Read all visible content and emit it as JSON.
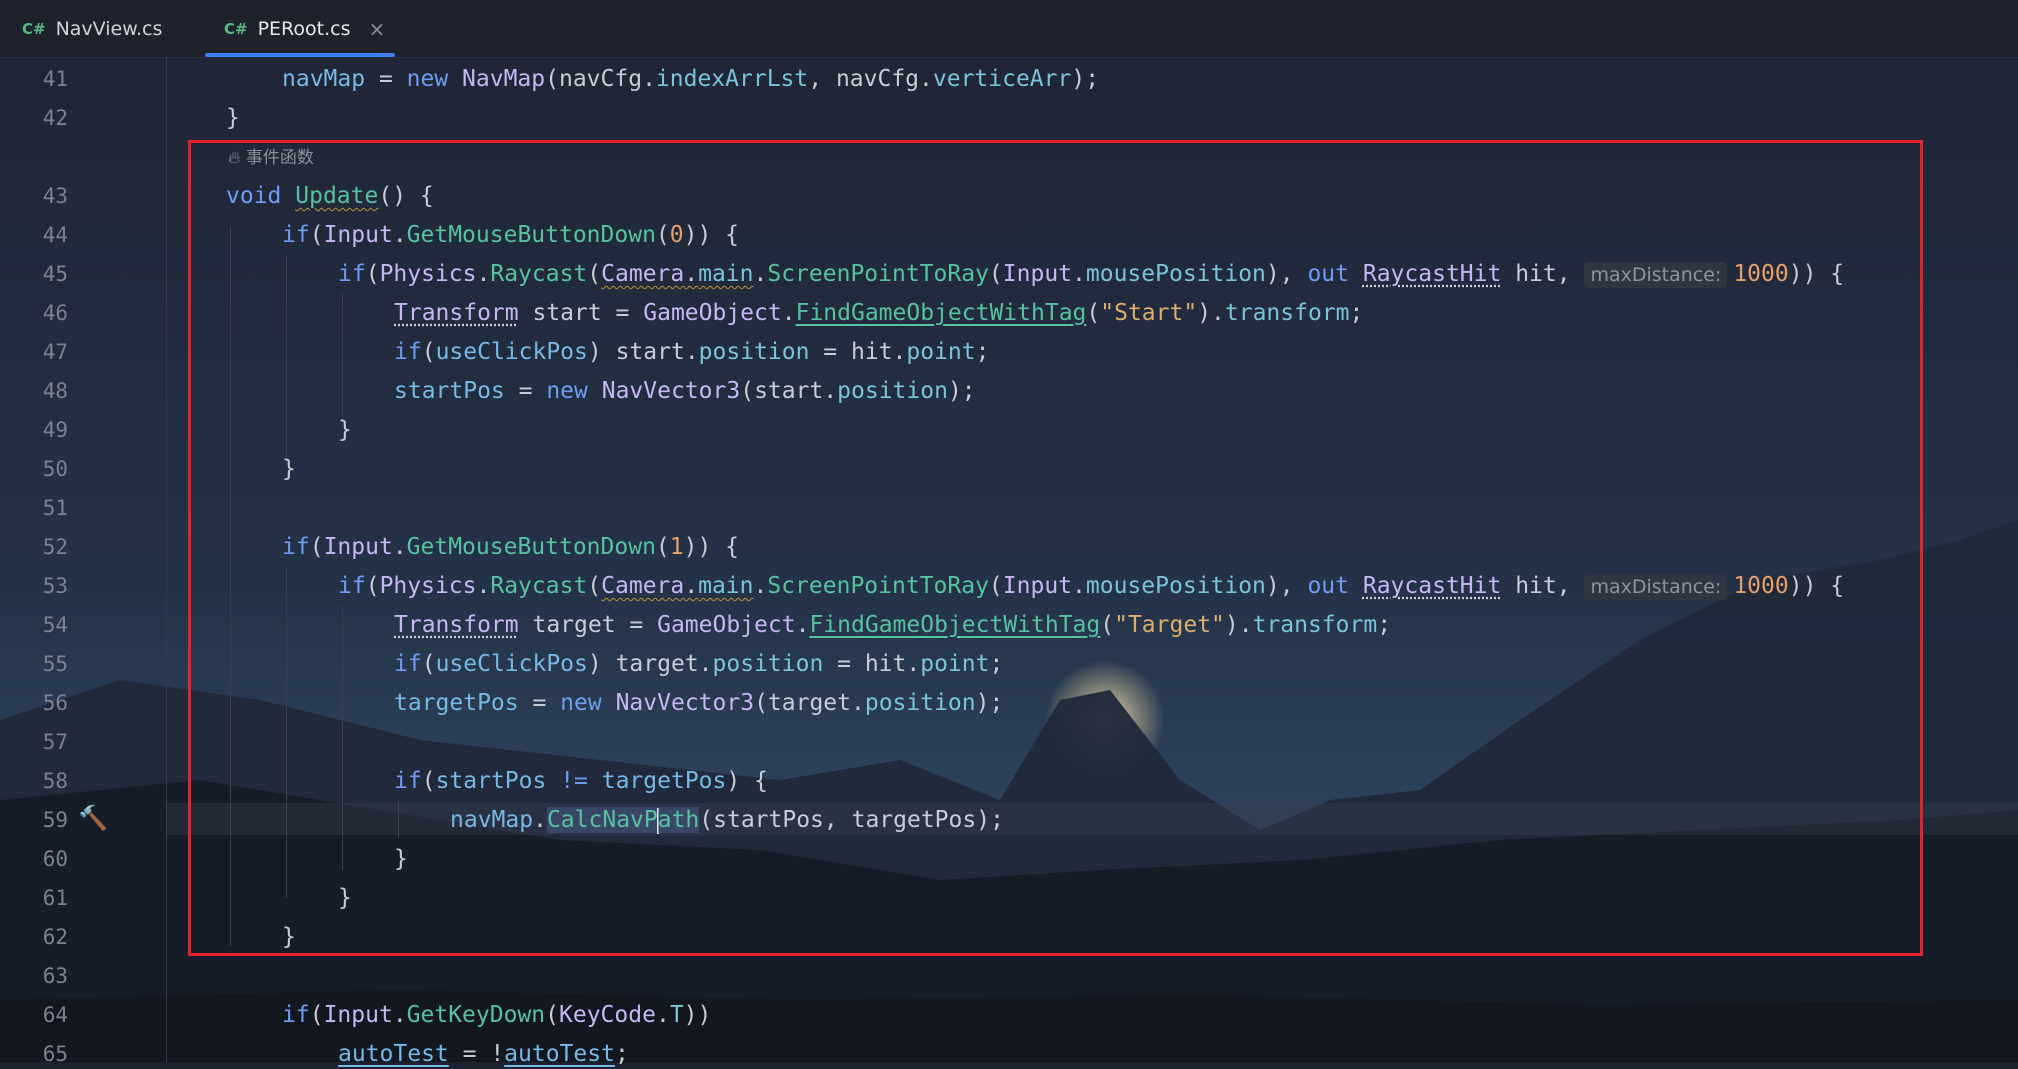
{
  "tabs": [
    {
      "lang": "C#",
      "label": "NavView.cs",
      "active": false
    },
    {
      "lang": "C#",
      "label": "PERoot.cs",
      "active": true,
      "close": "×"
    }
  ],
  "codevision": {
    "icon": "flame-icon",
    "label": "事件函数"
  },
  "line_numbers": [
    "41",
    "42",
    "43",
    "44",
    "45",
    "46",
    "47",
    "48",
    "49",
    "50",
    "51",
    "52",
    "53",
    "54",
    "55",
    "56",
    "57",
    "58",
    "59",
    "60",
    "61",
    "62",
    "63",
    "64",
    "65"
  ],
  "code": {
    "l41": {
      "navMap": "navMap",
      "eq": " = ",
      "new": "new",
      "NavMap": "NavMap",
      "args": "(navCfg.",
      "indexArrLst": "indexArrLst",
      ",": ", navCfg.",
      "verticeArr": "verticeArr",
      "end": ");"
    },
    "l42": "}",
    "l43": {
      "void": "void",
      "Update": "Update",
      "rest": "() {"
    },
    "l44": {
      "if": "if",
      "open": "(",
      "Input": "Input",
      "dot": ".",
      "GetMouseButtonDown": "GetMouseButtonDown",
      "p": "(",
      "n": "0",
      "end": ")) {"
    },
    "l45": {
      "if": "if",
      "open": "(",
      "Physics": "Physics",
      "Raycast": "Raycast",
      "Camera": "Camera",
      "main": "main",
      "ScreenPointToRay": "ScreenPointToRay",
      "Input": "Input",
      "mousePosition": "mousePosition",
      "out": "out",
      "RaycastHit": "RaycastHit",
      "hit": " hit, ",
      "hint": "maxDistance:",
      "num": "1000",
      "end": ")) {"
    },
    "l46": {
      "Transform": "Transform",
      "var": " start = ",
      "GameObject": "GameObject",
      "FindGameObjectWithTag": "FindGameObjectWithTag",
      "str": "\"Start\"",
      "transform": "transform",
      "end": ";"
    },
    "l47": {
      "if": "if",
      "useClickPos": "useClickPos",
      "mid": ") start.",
      "position": "position",
      "eq": " = hit.",
      "point": "point",
      "end": ";"
    },
    "l48": {
      "startPos": "startPos",
      "eq": " = ",
      "new": "new",
      "NavVector3": "NavVector3",
      "args": "(start.",
      "position": "position",
      "end": ");"
    },
    "l49": "}",
    "l50": "}",
    "l52": {
      "if": "if",
      "open": "(",
      "Input": "Input",
      "dot": ".",
      "GetMouseButtonDown": "GetMouseButtonDown",
      "p": "(",
      "n": "1",
      "end": ")) {"
    },
    "l53": {
      "if": "if",
      "open": "(",
      "Physics": "Physics",
      "Raycast": "Raycast",
      "Camera": "Camera",
      "main": "main",
      "ScreenPointToRay": "ScreenPointToRay",
      "Input": "Input",
      "mousePosition": "mousePosition",
      "out": "out",
      "RaycastHit": "RaycastHit",
      "hit": " hit, ",
      "hint": "maxDistance:",
      "num": "1000",
      "end": ")) {"
    },
    "l54": {
      "Transform": "Transform",
      "var": " target = ",
      "GameObject": "GameObject",
      "FindGameObjectWithTag": "FindGameObjectWithTag",
      "str": "\"Target\"",
      "transform": "transform",
      "end": ";"
    },
    "l55": {
      "if": "if",
      "useClickPos": "useClickPos",
      "mid": ") target.",
      "position": "position",
      "eq": " = hit.",
      "point": "point",
      "end": ";"
    },
    "l56": {
      "targetPos": "targetPos",
      "eq": " = ",
      "new": "new",
      "NavVector3": "NavVector3",
      "args": "(target.",
      "position": "position",
      "end": ");"
    },
    "l58": {
      "if": "if",
      "startPos": "startPos",
      "op": " != ",
      "targetPos": "targetPos",
      "end": ") {"
    },
    "l59": {
      "navMap": "navMap",
      "dot": ".",
      "CalcNav": "CalcNavP",
      "ath": "ath",
      "args": "(startPos, targetPos);"
    },
    "l60": "}",
    "l61": "}",
    "l62": "}",
    "l64": {
      "if": "if",
      "open": "(",
      "Input": "Input",
      "GetKeyDown": "GetKeyDown",
      "KeyCode": "KeyCode",
      "T": "T",
      "end": "))"
    },
    "l65": {
      "autoTest": "autoTest",
      "eq": " = !",
      "autoTest2": "autoTest",
      "end": ";"
    }
  },
  "colors": {
    "accent": "#3d7ef2",
    "highlight_box": "#e0232c"
  }
}
